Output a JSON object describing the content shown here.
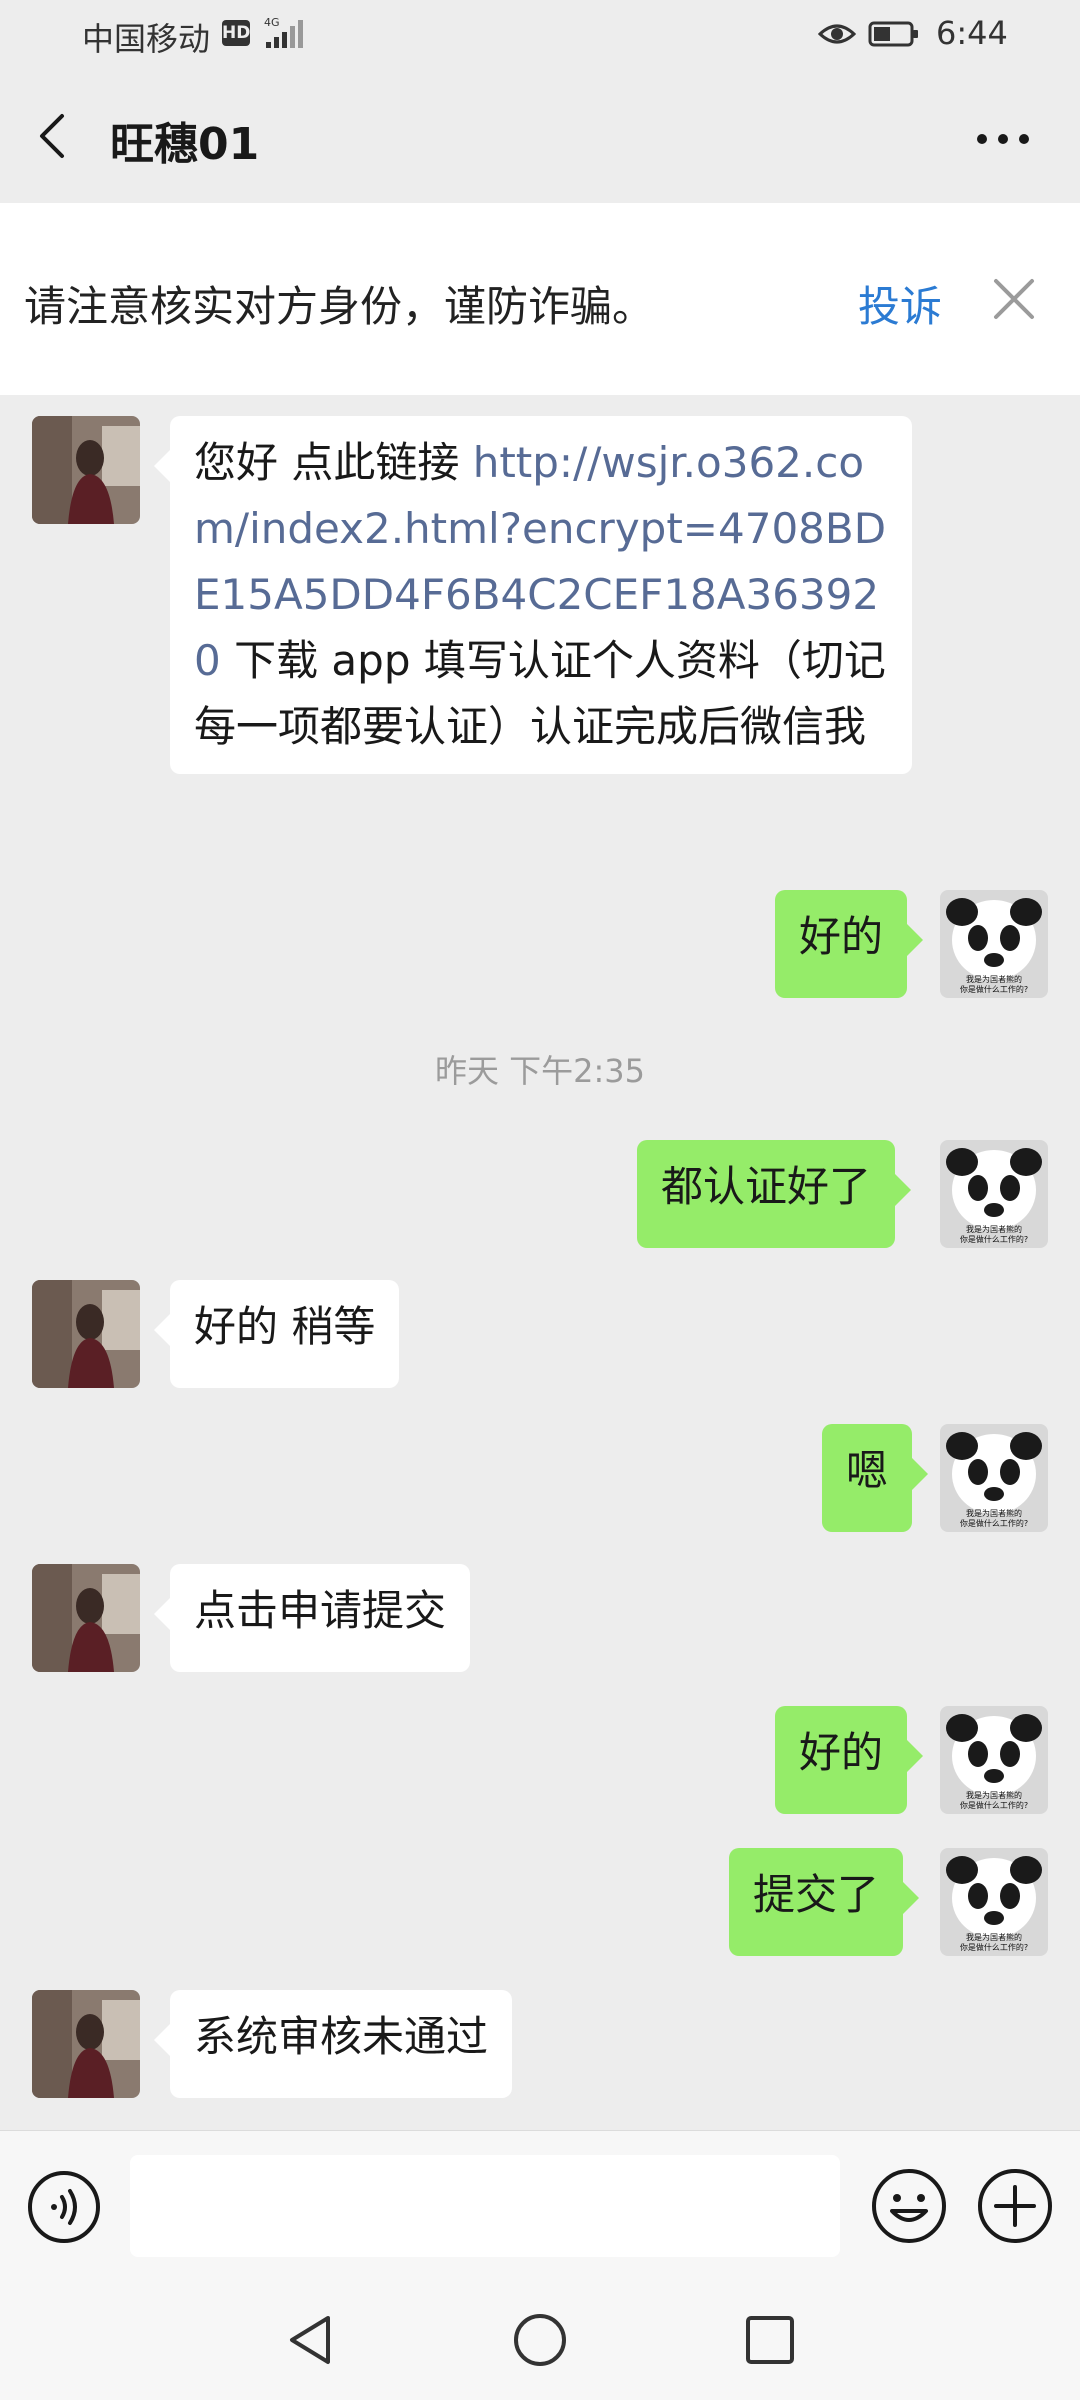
{
  "status_bar": {
    "carrier": "中国移动",
    "hd_badge": "HD",
    "network": "4G",
    "time": "6:44"
  },
  "header": {
    "title": "旺穗01"
  },
  "banner": {
    "text": "请注意核实对方身份，谨防诈骗。",
    "complain_label": "投诉"
  },
  "messages": [
    {
      "from": "contact",
      "parts": {
        "prefix": "您好 点此链接 ",
        "link": "http://wsjr.o362.com/index2.html?encrypt=4708BDE15A5DD4F6B4C2CEF18A363920",
        "suffix": " 下载 app 填写认证个人资料（切记每一项都要认证）认证完成后微信我"
      }
    },
    {
      "from": "me",
      "text": "好的"
    },
    {
      "from": "me",
      "text": "都认证好了"
    },
    {
      "from": "contact",
      "text": "好的 稍等"
    },
    {
      "from": "me",
      "text": "嗯"
    },
    {
      "from": "contact",
      "text": "点击申请提交"
    },
    {
      "from": "me",
      "text": "好的"
    },
    {
      "from": "me",
      "text": "提交了"
    },
    {
      "from": "contact",
      "text": "系统审核未通过"
    }
  ],
  "timestamp": "昨天 下午2:35",
  "sticker_caption": {
    "line1": "我是为国者熊的",
    "line2": "你是做什么工作的?"
  },
  "input": {
    "value": "",
    "placeholder": ""
  },
  "colors": {
    "background": "#ededed",
    "outgoing_bubble": "#95ec69",
    "incoming_bubble": "#ffffff",
    "link": "#576b95",
    "complain": "#2b7bd3"
  }
}
